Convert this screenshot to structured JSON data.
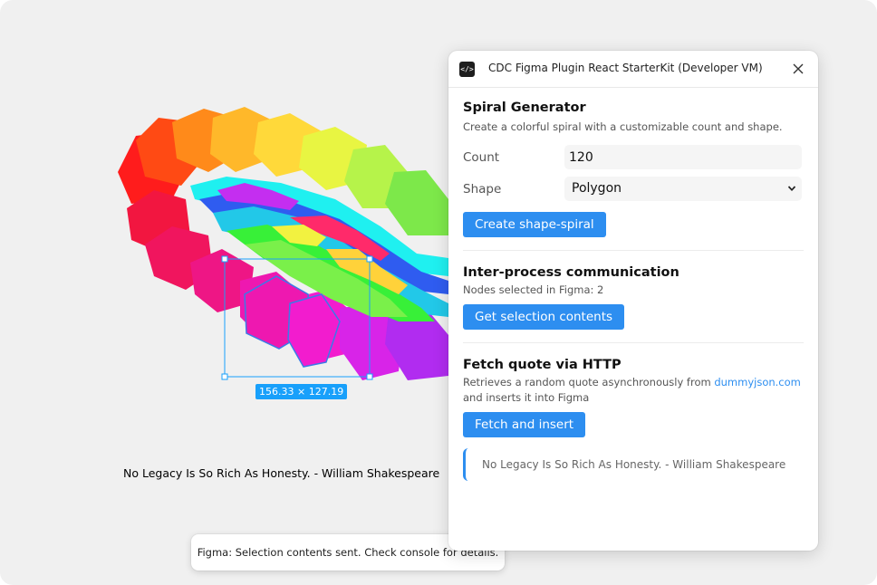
{
  "canvas": {
    "selection_dims": "156.33 × 127.19",
    "quote_text": "No Legacy Is So Rich As Honesty. - William Shakespeare"
  },
  "toast": {
    "message": "Figma: Selection contents sent. Check console for details."
  },
  "plugin": {
    "icon": "code-icon",
    "title": "CDC Figma Plugin React StarterKit (Developer VM)",
    "close_icon": "close-icon",
    "spiral": {
      "heading": "Spiral Generator",
      "description": "Create a colorful spiral with a customizable count and shape.",
      "count_label": "Count",
      "count_value": "120",
      "shape_label": "Shape",
      "shape_value": "Polygon",
      "button": "Create shape-spiral"
    },
    "ipc": {
      "heading": "Inter-process communication",
      "status": "Nodes selected in Figma: 2",
      "button": "Get selection contents"
    },
    "fetch": {
      "heading": "Fetch quote via HTTP",
      "desc_before": "Retrieves a random quote asynchronously from ",
      "desc_link": "dummyjson.com",
      "desc_after": " and inserts it into Figma",
      "button": "Fetch and insert",
      "quote": "No Legacy Is So Rich As Honesty. - William Shakespeare"
    }
  },
  "colors": {
    "accent": "#2d8ef0",
    "selection": "#18a0fb"
  }
}
